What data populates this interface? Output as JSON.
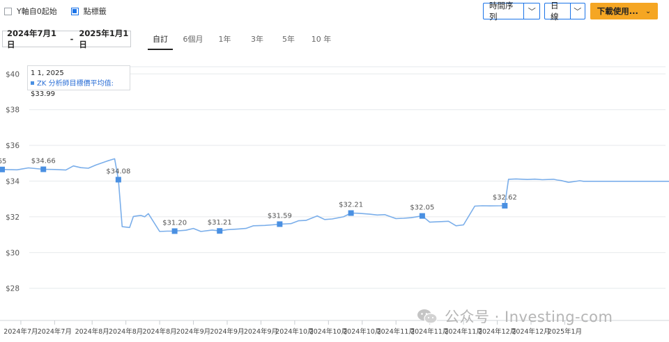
{
  "options": {
    "y_axis_zero": {
      "label": "Y軸自0起始",
      "checked": false
    },
    "point_markers": {
      "label": "點標籤",
      "checked": true
    }
  },
  "toolbar": {
    "series_type": "時間序列",
    "interval": "日線",
    "download": "下載使用...",
    "dropdown_glyph": "﹀",
    "download_glyph": "⌄"
  },
  "date_range": {
    "start": "2024年7月1日",
    "end": "2025年1月1日",
    "separator": "-"
  },
  "ranges": [
    "自訂",
    "6個月",
    "1年",
    "3年",
    "5年",
    "10 年"
  ],
  "active_range": "自訂",
  "tooltip": {
    "date": "1 1, 2025",
    "series": "ZK 分析師目標價平均值",
    "value": "$33.99"
  },
  "watermark": "公众号 · Investing-com",
  "colors": {
    "line": "#7aaeea",
    "marker": "#4a90e2",
    "grid": "#e6e9ec",
    "accent": "#1a73e8",
    "download_bg": "#f5a623"
  },
  "chart_data": {
    "type": "line",
    "series": [
      {
        "name": "ZK 分析師目標價平均值",
        "x": [
          "2024-07-01",
          "2024-07-05",
          "2024-07-08",
          "2024-07-10",
          "2024-07-12",
          "2024-07-15",
          "2024-07-18",
          "2024-07-20",
          "2024-07-22",
          "2024-07-24",
          "2024-07-26",
          "2024-07-29",
          "2024-07-31",
          "2024-08-01",
          "2024-08-02",
          "2024-08-04",
          "2024-08-05",
          "2024-08-06",
          "2024-08-07",
          "2024-08-08",
          "2024-08-09",
          "2024-08-12",
          "2024-08-14",
          "2024-08-16",
          "2024-08-19",
          "2024-08-21",
          "2024-08-23",
          "2024-08-26",
          "2024-08-28",
          "2024-08-30",
          "2024-09-02",
          "2024-09-04",
          "2024-09-06",
          "2024-09-09",
          "2024-09-11",
          "2024-09-13",
          "2024-09-16",
          "2024-09-18",
          "2024-09-20",
          "2024-09-23",
          "2024-09-25",
          "2024-09-27",
          "2024-09-30",
          "2024-10-02",
          "2024-10-04",
          "2024-10-07",
          "2024-10-09",
          "2024-10-11",
          "2024-10-14",
          "2024-10-16",
          "2024-10-18",
          "2024-10-21",
          "2024-10-23",
          "2024-10-25",
          "2024-10-28",
          "2024-10-30",
          "2024-11-01",
          "2024-11-04",
          "2024-11-06",
          "2024-11-08",
          "2024-11-11",
          "2024-11-12",
          "2024-11-13",
          "2024-11-15",
          "2024-11-18",
          "2024-11-20",
          "2024-11-22",
          "2024-11-25",
          "2024-11-26",
          "2024-11-27",
          "2024-11-29",
          "2024-12-02",
          "2024-12-03",
          "2024-12-04",
          "2024-12-06",
          "2024-12-09",
          "2024-12-11",
          "2024-12-13",
          "2024-12-16",
          "2024-12-18",
          "2024-12-20",
          "2024-12-23",
          "2024-12-27",
          "2025-01-01"
        ],
        "values": [
          34.65,
          34.63,
          34.74,
          34.7,
          34.66,
          34.65,
          34.62,
          34.85,
          34.75,
          34.72,
          34.9,
          35.12,
          35.25,
          34.08,
          31.45,
          31.4,
          32.02,
          32.05,
          32.08,
          32.0,
          32.18,
          31.18,
          31.2,
          31.2,
          31.25,
          31.35,
          31.18,
          31.26,
          31.21,
          31.28,
          31.32,
          31.35,
          31.5,
          31.52,
          31.55,
          31.59,
          31.62,
          31.78,
          31.8,
          32.05,
          31.85,
          31.88,
          32.0,
          32.21,
          32.2,
          32.15,
          32.1,
          32.12,
          31.9,
          31.92,
          31.95,
          32.05,
          31.7,
          31.72,
          31.75,
          31.5,
          31.55,
          32.6,
          32.62,
          32.61,
          32.62,
          32.64,
          34.1,
          34.12,
          34.09,
          34.11,
          34.08,
          34.1,
          34.06,
          34.03,
          33.93,
          34.02,
          33.99,
          33.99,
          33.99,
          33.99,
          33.99,
          33.99,
          33.99,
          33.99,
          33.99,
          33.99,
          33.99,
          33.99
        ]
      }
    ],
    "markers": [
      {
        "x": "2024-07-01",
        "value": 34.65,
        "label": "65"
      },
      {
        "x": "2024-07-12",
        "value": 34.66,
        "label": "$34.66"
      },
      {
        "x": "2024-08-01",
        "value": 34.08,
        "label": "$34.08"
      },
      {
        "x": "2024-08-16",
        "value": 31.2,
        "label": "$31.20"
      },
      {
        "x": "2024-08-28",
        "value": 31.21,
        "label": "$31.21"
      },
      {
        "x": "2024-09-13",
        "value": 31.59,
        "label": "$31.59"
      },
      {
        "x": "2024-10-02",
        "value": 32.21,
        "label": "$32.21"
      },
      {
        "x": "2024-10-21",
        "value": 32.05,
        "label": "$32.05"
      },
      {
        "x": "2024-11-12",
        "value": 32.62,
        "label": "$32.62"
      }
    ],
    "y_ticks": [
      "$28",
      "$30",
      "$32",
      "$34",
      "$36",
      "$38",
      "$40"
    ],
    "y_tick_values": [
      28,
      30,
      32,
      34,
      36,
      38,
      40
    ],
    "ylim": [
      26.2,
      40.4
    ],
    "x_ticks": [
      "2024年7月",
      "2024年7月",
      "2024年8月",
      "2024年8月",
      "2024年8月",
      "2024年9月",
      "2024年9月",
      "2024年9月",
      "2024年10月",
      "2024年10月",
      "2024年10月",
      "2024年11月",
      "2024年11月",
      "2024年11月",
      "2024年12月",
      "2024年12月",
      "2025年1月"
    ],
    "x_tick_values": [
      "2024-07-06",
      "2024-07-15",
      "2024-07-25",
      "2024-08-03",
      "2024-08-12",
      "2024-08-21",
      "2024-08-30",
      "2024-09-08",
      "2024-09-17",
      "2024-09-26",
      "2024-10-05",
      "2024-10-14",
      "2024-10-23",
      "2024-11-01",
      "2024-11-10",
      "2024-11-19",
      "2024-11-28"
    ],
    "xlim": [
      "2024-07-01",
      "2024-12-02"
    ],
    "grid": true,
    "legend": "none"
  }
}
